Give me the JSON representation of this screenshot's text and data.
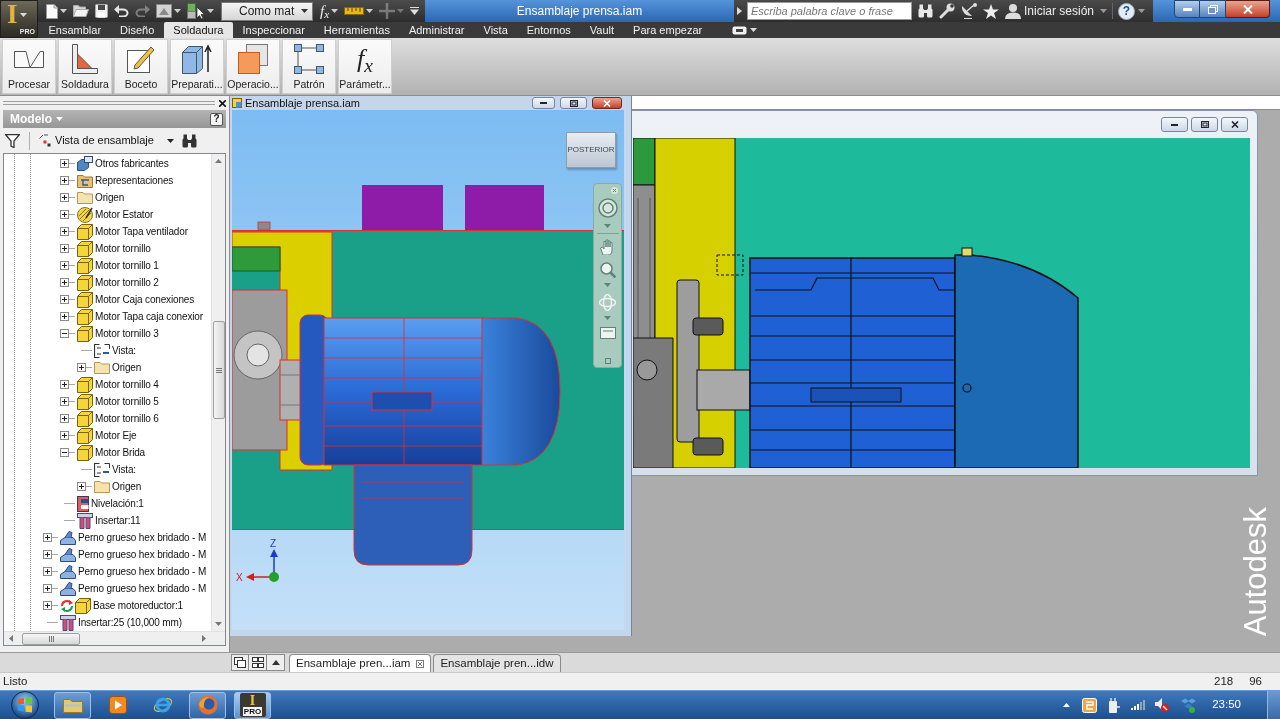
{
  "app_button": {
    "logo": "I",
    "badge": "PRO"
  },
  "quick_access": [
    {
      "kind": "new",
      "menu": true,
      "disabled": false
    },
    {
      "kind": "open",
      "menu": false,
      "disabled": false
    },
    {
      "kind": "save",
      "menu": false,
      "disabled": false
    },
    {
      "kind": "undo",
      "menu": false,
      "disabled": false
    },
    {
      "kind": "redo",
      "menu": false,
      "disabled": true
    },
    {
      "kind": "appearance",
      "menu": true,
      "disabled": false
    },
    {
      "kind": "select",
      "menu": true,
      "disabled": false
    },
    {
      "kind": "material",
      "value": "Como mat",
      "menu": true,
      "disabled": false
    },
    {
      "kind": "formula",
      "symbol": "f$_{x}$",
      "menu": true,
      "disabled": false
    },
    {
      "kind": "measure",
      "menu": true,
      "disabled": false
    },
    {
      "kind": "origin",
      "menu": true,
      "disabled": true
    },
    {
      "kind": "customize",
      "menu": false,
      "disabled": false
    }
  ],
  "window": {
    "title": "Ensamblaje prensa.iam"
  },
  "infocenter": {
    "placeholder": "Escriba palabra clave o frase",
    "sign_in": "Iniciar sesión",
    "help": "?"
  },
  "tabs": [
    {
      "label": "Ensamblar",
      "selected": false
    },
    {
      "label": "Diseño",
      "selected": false
    },
    {
      "label": "Soldadura",
      "selected": true
    },
    {
      "label": "Inspeccionar",
      "selected": false
    },
    {
      "label": "Herramientas",
      "selected": false
    },
    {
      "label": "Administrar",
      "selected": false
    },
    {
      "label": "Vista",
      "selected": false
    },
    {
      "label": "Entornos",
      "selected": false
    },
    {
      "label": "Vault",
      "selected": false
    },
    {
      "label": "Para empezar",
      "selected": false
    }
  ],
  "ribbon": [
    {
      "label": "Procesar",
      "kind": "process"
    },
    {
      "label": "Soldadura",
      "kind": "weld"
    },
    {
      "label": "Boceto",
      "kind": "sketch"
    },
    {
      "label": "Preparati...",
      "kind": "preparation"
    },
    {
      "label": "Operacio...",
      "kind": "machining"
    },
    {
      "label": "Patrón",
      "kind": "pattern"
    },
    {
      "label": "Parámetr...",
      "kind": "parameters",
      "symbol": "f$_{x}$"
    }
  ],
  "browser": {
    "title": "Modelo",
    "help": "?",
    "view": "Vista de ensamblaje",
    "tree": {
      "items": [
        {
          "children": [
            {
              "label": "Otros fabricantes",
              "kind": "thirdparty",
              "expanded": false
            },
            {
              "label": "Representaciones",
              "kind": "representations",
              "expanded": false
            },
            {
              "label": "Origen",
              "kind": "folder",
              "expanded": false
            },
            {
              "label": "Motor Estator",
              "kind": "adaptive",
              "expanded": false
            },
            {
              "label": "Motor Tapa ventilador",
              "kind": "part",
              "expanded": false
            },
            {
              "label": "Motor tornillo",
              "kind": "part",
              "expanded": false
            },
            {
              "label": "Motor tornillo 1",
              "kind": "part",
              "expanded": false
            },
            {
              "label": "Motor tornillo 2",
              "kind": "part",
              "expanded": false
            },
            {
              "label": "Motor Caja conexiones",
              "kind": "part",
              "expanded": false
            },
            {
              "label": "Motor Tapa caja conexior",
              "kind": "part",
              "expanded": false
            },
            {
              "label": "Motor tornillo 3",
              "kind": "part",
              "expanded": true,
              "children": [
                {
                  "label": "Vista:",
                  "kind": "view"
                },
                {
                  "label": "Origen",
                  "kind": "folder",
                  "expanded": false
                }
              ]
            },
            {
              "label": "Motor tornillo 4",
              "kind": "part",
              "expanded": false
            },
            {
              "label": "Motor tornillo 5",
              "kind": "part",
              "expanded": false
            },
            {
              "label": "Motor tornillo 6",
              "kind": "part",
              "expanded": false
            },
            {
              "label": "Motor Eje",
              "kind": "part",
              "expanded": false
            },
            {
              "label": "Motor Brida",
              "kind": "part",
              "expanded": true,
              "children": [
                {
                  "label": "Vista:",
                  "kind": "view"
                },
                {
                  "label": "Origen",
                  "kind": "folder",
                  "expanded": false
                }
              ]
            },
            {
              "label": "Nivelación:1",
              "kind": "leveling"
            },
            {
              "label": "Insertar:11",
              "kind": "insert"
            }
          ]
        },
        {
          "label": "Perno grueso hex bridado - M",
          "kind": "bolt",
          "expanded": false
        },
        {
          "label": "Perno grueso hex bridado - M",
          "kind": "bolt",
          "expanded": false
        },
        {
          "label": "Perno grueso hex bridado - M",
          "kind": "bolt",
          "expanded": false
        },
        {
          "label": "Perno grueso hex bridado - M",
          "kind": "bolt",
          "expanded": false
        },
        {
          "label": "Base motoreductor:1",
          "kind": "subassembly",
          "expanded": false
        },
        {
          "label": "Insertar:25 (10,000 mm)",
          "kind": "insert"
        }
      ]
    }
  },
  "documents": [
    {
      "kind": "model",
      "title": "Ensamblaje prensa.iam",
      "view_cube": "POSTERIOR",
      "axes": {
        "z": "Z",
        "x": "X"
      }
    },
    {
      "kind": "detail"
    }
  ],
  "brand": "Autodesk",
  "document_tabs": [
    {
      "label": "Ensamblaje pren...iam",
      "selected": true
    },
    {
      "label": "Ensamblaje pren...idw",
      "selected": false
    }
  ],
  "status_bar": {
    "text": "Listo",
    "readings": [
      "218",
      "96"
    ]
  },
  "taskbar": {
    "apps": [
      {
        "kind": "files",
        "running": true,
        "active": false
      },
      {
        "kind": "media",
        "running": false,
        "active": false
      },
      {
        "kind": "ie",
        "running": false,
        "active": false
      },
      {
        "kind": "fox",
        "running": true,
        "active": false
      },
      {
        "kind": "cad",
        "running": true,
        "active": true,
        "logo": "I",
        "badge": "PRO"
      }
    ],
    "clock": "23:50"
  }
}
